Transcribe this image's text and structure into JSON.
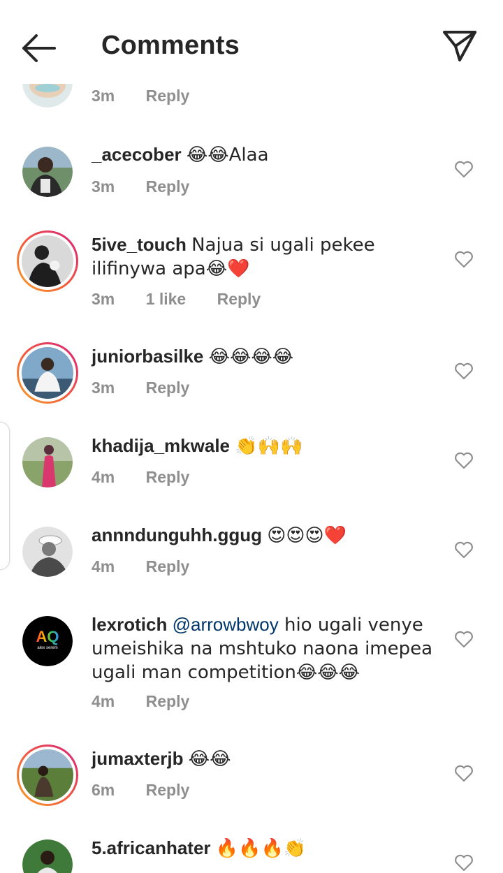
{
  "header": {
    "title": "Comments",
    "back_icon": "arrow-left-icon",
    "send_icon": "paper-plane-icon"
  },
  "colors": {
    "text": "#262626",
    "meta": "#8e8e8e",
    "mention": "#00376b",
    "story_ring_start": "#f9a42a",
    "story_ring_end": "#d81f7b"
  },
  "partial_comment": {
    "time": "3m",
    "reply": "Reply"
  },
  "comments": [
    {
      "username": "_acecober",
      "text": "😂😂Alaa",
      "time": "3m",
      "reply": "Reply"
    },
    {
      "username": "5ive_touch",
      "text": "Najua si ugali pekee ilifinywa apa😂❤️",
      "time": "3m",
      "likes": "1 like",
      "reply": "Reply"
    },
    {
      "username": "juniorbasilke",
      "text": "😂😂😂😂",
      "time": "3m",
      "reply": "Reply"
    },
    {
      "username": "khadija_mkwale",
      "text": "👏🙌🙌",
      "time": "4m",
      "reply": "Reply"
    },
    {
      "username": "annndunguhh.ggug",
      "text": "😍😍😍❤️",
      "time": "4m",
      "reply": "Reply"
    },
    {
      "username": "lexrotich",
      "mention": "@arrowbwoy",
      "text": " hio ugali venye umeishika na mshtuko naona imepea ugali man competition😂😂😂",
      "time": "4m",
      "reply": "Reply",
      "avatar_logo": "AQ",
      "avatar_caption": "alex serem"
    },
    {
      "username": "jumaxterjb",
      "text": "😂😂",
      "time": "6m",
      "reply": "Reply"
    },
    {
      "username": "5.africanhater",
      "text": "🔥🔥🔥👏"
    }
  ]
}
